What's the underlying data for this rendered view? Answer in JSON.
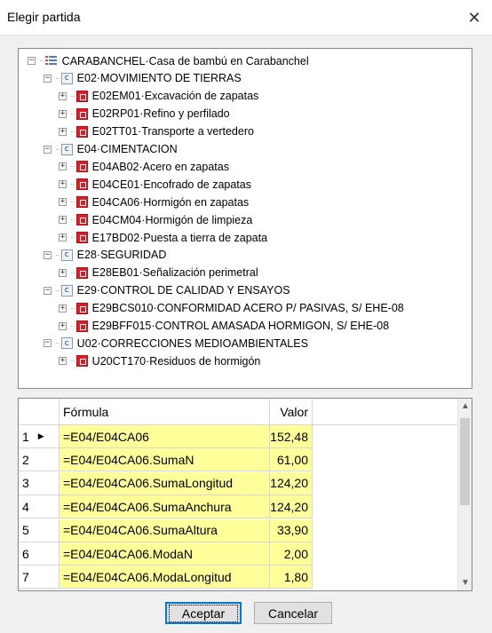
{
  "window": {
    "title": "Elegir partida",
    "close_glyph": "✕"
  },
  "tree": {
    "root": {
      "code": "CARABANCHEL",
      "desc": "Casa de bambú en Carabanchel",
      "icon": "budget-icon"
    },
    "chapters": [
      {
        "code": "E02",
        "desc": "MOVIMIENTO DE TIERRAS",
        "items": [
          {
            "code": "E02EM01",
            "desc": "Excavación de zapatas"
          },
          {
            "code": "E02RP01",
            "desc": "Refino y perfilado"
          },
          {
            "code": "E02TT01",
            "desc": "Transporte a vertedero"
          }
        ]
      },
      {
        "code": "E04",
        "desc": "CIMENTACION",
        "items": [
          {
            "code": "E04AB02",
            "desc": "Acero en zapatas"
          },
          {
            "code": "E04CE01",
            "desc": "Encofrado de zapatas"
          },
          {
            "code": "E04CA06",
            "desc": "Hormigón en zapatas"
          },
          {
            "code": "E04CM04",
            "desc": "Hormigón de limpieza"
          },
          {
            "code": "E17BD02",
            "desc": "Puesta a tierra de zapata"
          }
        ]
      },
      {
        "code": "E28",
        "desc": "SEGURIDAD",
        "items": [
          {
            "code": "E28EB01",
            "desc": "Señalización perimetral"
          }
        ]
      },
      {
        "code": "E29",
        "desc": "CONTROL DE CALIDAD Y ENSAYOS",
        "items": [
          {
            "code": "E29BCS010",
            "desc": "CONFORMIDAD ACERO P/ PASIVAS, S/ EHE-08"
          },
          {
            "code": "E29BFF015",
            "desc": "CONTROL AMASADA HORMIGON, S/ EHE-08"
          }
        ]
      },
      {
        "code": "U02",
        "desc": "CORRECCIONES MEDIOAMBIENTALES",
        "items": [
          {
            "code": "U20CT170",
            "desc": "Residuos de hormigón"
          }
        ]
      }
    ],
    "separator": " · ",
    "expand_glyph": "+",
    "collapse_glyph": "−"
  },
  "grid": {
    "columns": [
      "Fórmula",
      "Valor"
    ],
    "current_row_marker": "▶",
    "rows": [
      {
        "n": "1",
        "formula": "=E04/E04CA06",
        "value": "152,48"
      },
      {
        "n": "2",
        "formula": "=E04/E04CA06.SumaN",
        "value": "61,00"
      },
      {
        "n": "3",
        "formula": "=E04/E04CA06.SumaLongitud",
        "value": "124,20"
      },
      {
        "n": "4",
        "formula": "=E04/E04CA06.SumaAnchura",
        "value": "124,20"
      },
      {
        "n": "5",
        "formula": "=E04/E04CA06.SumaAltura",
        "value": "33,90"
      },
      {
        "n": "6",
        "formula": "=E04/E04CA06.ModaN",
        "value": "2,00"
      },
      {
        "n": "7",
        "formula": "=E04/E04CA06.ModaLongitud",
        "value": "1,80"
      }
    ],
    "scroll_up_glyph": "▲",
    "scroll_down_glyph": "▼"
  },
  "buttons": {
    "ok": "Aceptar",
    "cancel": "Cancelar"
  },
  "colors": {
    "formula_bg": "#ffff99",
    "partida_icon": "#e01b24",
    "focus": "#0078d7"
  }
}
